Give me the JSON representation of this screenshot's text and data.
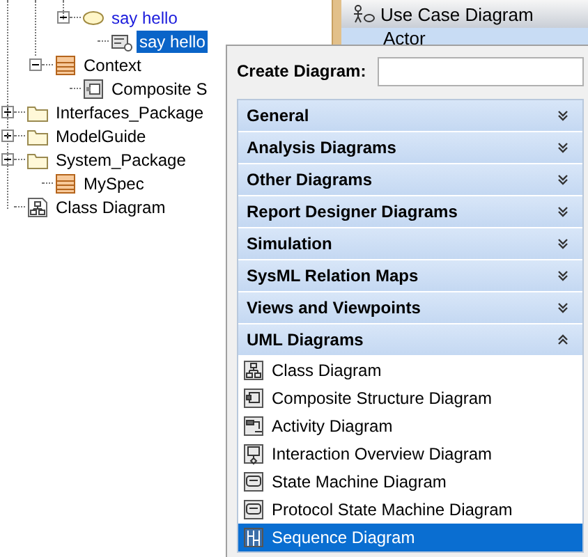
{
  "tree": {
    "items": [
      {
        "children": [
          {
            "children": [
              {
                "label": "say hello",
                "kind": "use_case",
                "expanded": true,
                "selected": false,
                "children": [
                  {
                    "label": "say hello",
                    "kind": "interaction",
                    "selected": true
                  }
                ]
              }
            ]
          },
          {
            "label": "Context",
            "kind": "class",
            "expanded": true,
            "selected": false,
            "children": [
              {
                "label": "Composite S",
                "kind": "composite",
                "selected": false
              }
            ]
          }
        ]
      },
      {
        "label": "Interfaces_Package",
        "kind": "package",
        "expanded": false,
        "selected": false
      },
      {
        "label": "ModelGuide",
        "kind": "package",
        "expanded": false,
        "selected": false
      },
      {
        "label": "System_Package",
        "kind": "package",
        "expanded": true,
        "selected": false,
        "children": [
          {
            "label": "MySpec",
            "kind": "class",
            "selected": false
          }
        ]
      },
      {
        "label": "Class Diagram",
        "kind": "class_diagram",
        "selected": false
      }
    ]
  },
  "palette": {
    "header": "Use Case Diagram",
    "items": [
      {
        "label": "Actor"
      }
    ]
  },
  "popup": {
    "label": "Create Diagram:",
    "groups": [
      {
        "label": "General",
        "expanded": false
      },
      {
        "label": "Analysis Diagrams",
        "expanded": false
      },
      {
        "label": "Other Diagrams",
        "expanded": false
      },
      {
        "label": "Report Designer Diagrams",
        "expanded": false
      },
      {
        "label": "Simulation",
        "expanded": false
      },
      {
        "label": "SysML Relation Maps",
        "expanded": false
      },
      {
        "label": "Views and Viewpoints",
        "expanded": false
      },
      {
        "label": "UML Diagrams",
        "expanded": true,
        "items": [
          {
            "label": "Class Diagram",
            "kind": "class",
            "selected": false
          },
          {
            "label": "Composite Structure Diagram",
            "kind": "composite",
            "selected": false
          },
          {
            "label": "Activity Diagram",
            "kind": "activity",
            "selected": false
          },
          {
            "label": "Interaction Overview Diagram",
            "kind": "overview",
            "selected": false
          },
          {
            "label": "State Machine Diagram",
            "kind": "state",
            "selected": false
          },
          {
            "label": "Protocol State Machine Diagram",
            "kind": "state",
            "selected": false
          },
          {
            "label": "Sequence Diagram",
            "kind": "sequence",
            "selected": true
          }
        ]
      }
    ]
  }
}
